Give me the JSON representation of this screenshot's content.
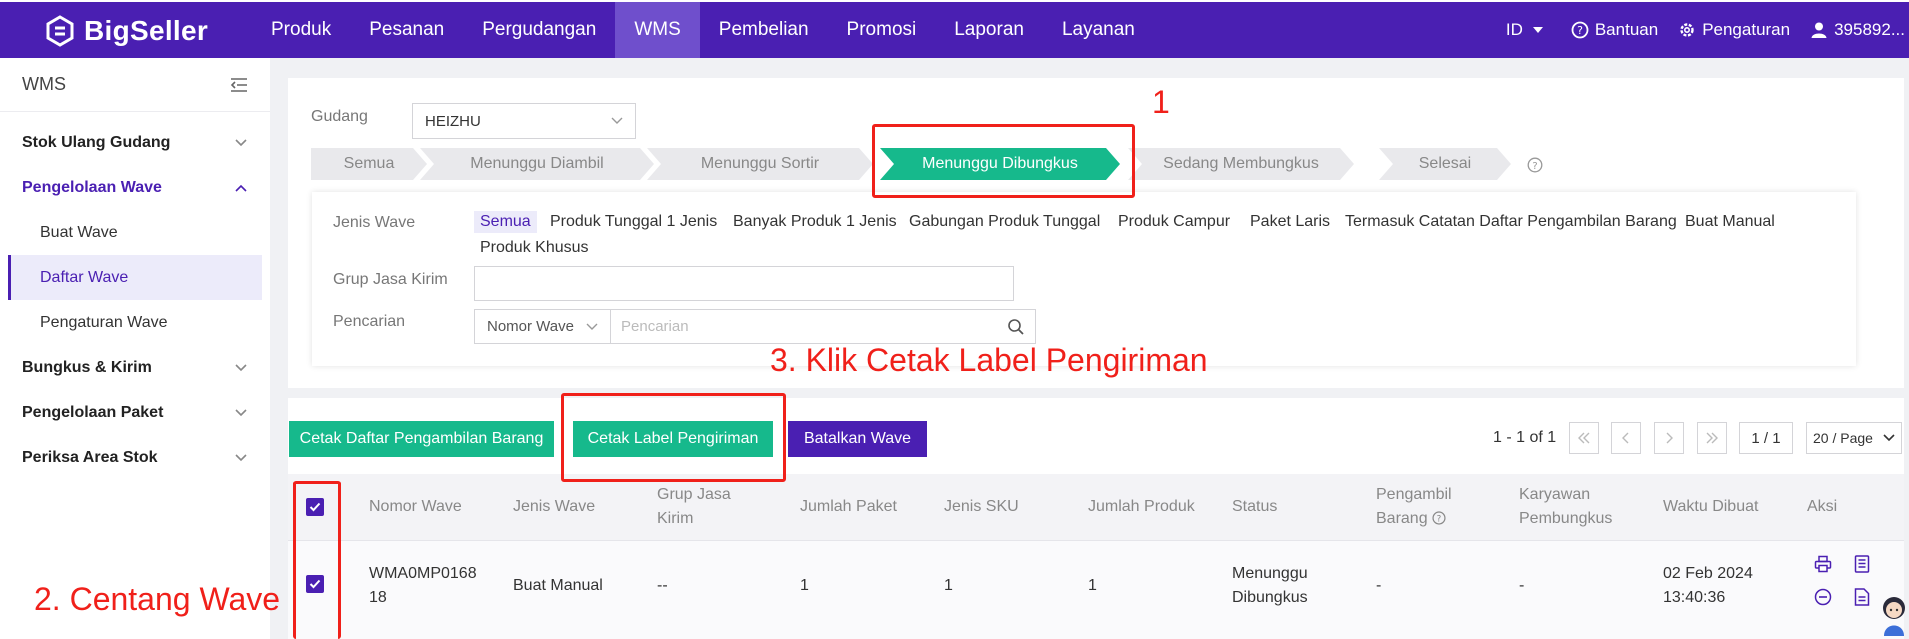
{
  "brand": "BigSeller",
  "nav": [
    "Produk",
    "Pesanan",
    "Pergudangan",
    "WMS",
    "Pembelian",
    "Promosi",
    "Laporan",
    "Layanan"
  ],
  "topright": {
    "lang": "ID",
    "help": "Bantuan",
    "settings": "Pengaturan",
    "user": "395892..."
  },
  "sidebar": {
    "title": "WMS",
    "items": [
      {
        "label": "Stok Ulang Gudang"
      },
      {
        "label": "Pengelolaan Wave"
      },
      {
        "label": "Bungkus & Kirim"
      },
      {
        "label": "Pengelolaan Paket"
      },
      {
        "label": "Periksa Area Stok"
      }
    ],
    "subitems": [
      "Buat Wave",
      "Daftar Wave",
      "Pengaturan Wave"
    ]
  },
  "filters": {
    "warehouse_label": "Gudang",
    "warehouse_value": "HEIZHU",
    "steps": [
      "Semua",
      "Menunggu Diambil",
      "Menunggu Sortir",
      "Menunggu Dibungkus",
      "Sedang Membungkus",
      "Selesai"
    ],
    "wave_type_label": "Jenis Wave",
    "wave_types": [
      "Semua",
      "Produk Tunggal 1 Jenis",
      "Banyak Produk 1 Jenis",
      "Gabungan Produk Tunggal",
      "Produk Campur",
      "Paket Laris",
      "Termasuk Catatan Daftar Pengambilan Barang",
      "Buat Manual",
      "Produk Khusus"
    ],
    "carrier_label": "Grup Jasa Kirim",
    "search_label": "Pencarian",
    "search_field": "Nomor Wave",
    "search_placeholder": "Pencarian"
  },
  "actions": {
    "print_pick_list": "Cetak Daftar Pengambilan Barang",
    "print_label": "Cetak Label Pengiriman",
    "cancel_wave": "Batalkan Wave"
  },
  "pagination": {
    "range": "1 - 1 of 1",
    "page": "1 / 1",
    "page_size": "20 / Page"
  },
  "table": {
    "headers": {
      "wave_no": "Nomor Wave",
      "wave_type": "Jenis Wave",
      "carrier_group": "Grup Jasa Kirim",
      "package_count": "Jumlah Paket",
      "sku_types": "Jenis SKU",
      "product_count": "Jumlah Produk",
      "status": "Status",
      "picker": "Pengambil Barang",
      "packer": "Karyawan Pembungkus",
      "created": "Waktu Dibuat",
      "actions": "Aksi"
    },
    "row": {
      "wave_no_1": "WMA0MP0168",
      "wave_no_2": "18",
      "wave_type": "Buat Manual",
      "carrier_group": "--",
      "package_count": "1",
      "sku_types": "1",
      "product_count": "1",
      "status_1": "Menunggu",
      "status_2": "Dibungkus",
      "picker": "-",
      "packer": "-",
      "created_1": "02 Feb 2024",
      "created_2": "13:40:36"
    }
  },
  "annotations": {
    "step1": "1",
    "step2": "2. Centang Wave",
    "step3": "3. Klik Cetak Label Pengiriman"
  },
  "colors": {
    "brand": "#4a1fb2",
    "accent": "#16b98c",
    "annotation": "#f0201a"
  }
}
